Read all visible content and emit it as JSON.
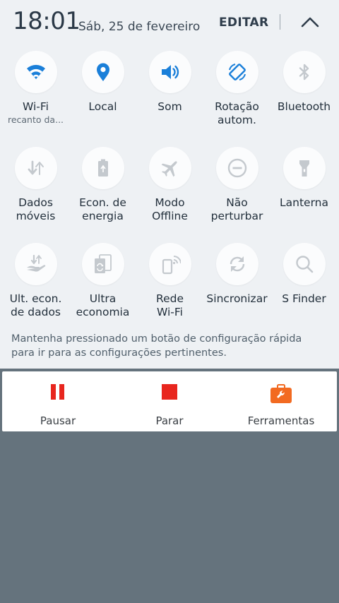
{
  "header": {
    "time": "18:01",
    "date": "Sáb, 25 de fevereiro",
    "edit_label": "EDITAR"
  },
  "tiles": [
    {
      "label": "Wi-Fi",
      "sub": "recanto da...",
      "icon": "wifi-icon",
      "active": true
    },
    {
      "label": "Local",
      "icon": "location-icon",
      "active": true
    },
    {
      "label": "Som",
      "icon": "volume-icon",
      "active": true
    },
    {
      "label": "Rotação\nautom.",
      "icon": "rotate-icon",
      "active": true
    },
    {
      "label": "Bluetooth",
      "icon": "bluetooth-icon",
      "active": false
    },
    {
      "label": "Dados\nmóveis",
      "icon": "mobile-data-icon",
      "active": false
    },
    {
      "label": "Econ. de\nenergia",
      "icon": "battery-saver-icon",
      "active": false
    },
    {
      "label": "Modo\nOffline",
      "icon": "airplane-icon",
      "active": false
    },
    {
      "label": "Não\nperturbar",
      "icon": "do-not-disturb-icon",
      "active": false
    },
    {
      "label": "Lanterna",
      "icon": "flashlight-icon",
      "active": false
    },
    {
      "label": "Ult. econ.\nde dados",
      "icon": "data-saver-icon",
      "active": false
    },
    {
      "label": "Ultra\neconomia",
      "icon": "ultra-power-saving-icon",
      "active": false
    },
    {
      "label": "Rede\nWi-Fi",
      "icon": "wifi-hotspot-icon",
      "active": false
    },
    {
      "label": "Sincronizar",
      "icon": "sync-icon",
      "active": false
    },
    {
      "label": "S Finder",
      "icon": "search-icon",
      "active": false
    }
  ],
  "hint": "Mantenha pressionado um botão de configuração rápida para ir para as configurações pertinentes.",
  "media": {
    "pause_label": "Pausar",
    "stop_label": "Parar",
    "tools_label": "Ferramentas"
  },
  "colors": {
    "active": "#1a7fd9",
    "inactive": "#c4c9ce",
    "media_red": "#e8261e",
    "tools_orange": "#f26a21",
    "background": "#65737d",
    "panel": "#eef1f4"
  }
}
